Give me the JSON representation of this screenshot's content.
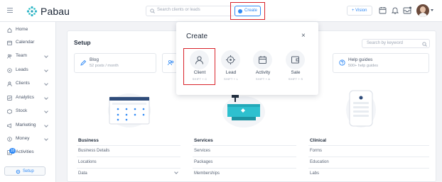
{
  "app": {
    "name": "Pabau"
  },
  "header": {
    "search_placeholder": "Search clients or leads",
    "create_label": "Create",
    "vision_label": "+ Vision"
  },
  "sidebar": {
    "items": [
      {
        "label": "Home",
        "icon": "home-icon",
        "has_chevron": false
      },
      {
        "label": "Calendar",
        "icon": "calendar-icon",
        "has_chevron": false
      },
      {
        "label": "Team",
        "icon": "team-icon",
        "has_chevron": true
      },
      {
        "label": "Leads",
        "icon": "leads-icon",
        "has_chevron": true
      },
      {
        "label": "Clients",
        "icon": "clients-icon",
        "has_chevron": true
      },
      {
        "label": "Analytics",
        "icon": "analytics-icon",
        "has_chevron": true
      },
      {
        "label": "Stock",
        "icon": "stock-icon",
        "has_chevron": true
      },
      {
        "label": "Marketing",
        "icon": "marketing-icon",
        "has_chevron": true
      },
      {
        "label": "Money",
        "icon": "money-icon",
        "has_chevron": true
      },
      {
        "label": "Activities",
        "icon": "activities-icon",
        "has_chevron": false
      }
    ],
    "activities_badge": "10",
    "setup_label": "Setup"
  },
  "main": {
    "title": "Setup",
    "search_placeholder": "Search by keyword",
    "tiles": [
      {
        "title": "Blog",
        "subtitle": "52 posts / month"
      },
      {
        "title": "Help guides",
        "subtitle": "500+ help guides"
      }
    ],
    "sections": [
      {
        "title": "Business",
        "items": [
          "Business Details",
          "Locations",
          "Data"
        ]
      },
      {
        "title": "Services",
        "items": [
          "Services",
          "Packages",
          "Memberships"
        ]
      },
      {
        "title": "Clinical",
        "items": [
          "Forms",
          "Education",
          "Labs"
        ]
      }
    ]
  },
  "modal": {
    "title": "Create",
    "close_glyph": "×",
    "options": [
      {
        "label": "Client",
        "shortcut": "SHIFT + C",
        "icon": "user-icon"
      },
      {
        "label": "Lead",
        "shortcut": "SHIFT + L",
        "icon": "target-icon"
      },
      {
        "label": "Activity",
        "shortcut": "SHIFT + A",
        "icon": "calendar-icon"
      },
      {
        "label": "Sale",
        "shortcut": "SHIFT + S",
        "icon": "wallet-icon"
      }
    ]
  },
  "colors": {
    "accent": "#2f89f5",
    "highlight": "#d9242b",
    "logo": "#2fb3c8"
  }
}
